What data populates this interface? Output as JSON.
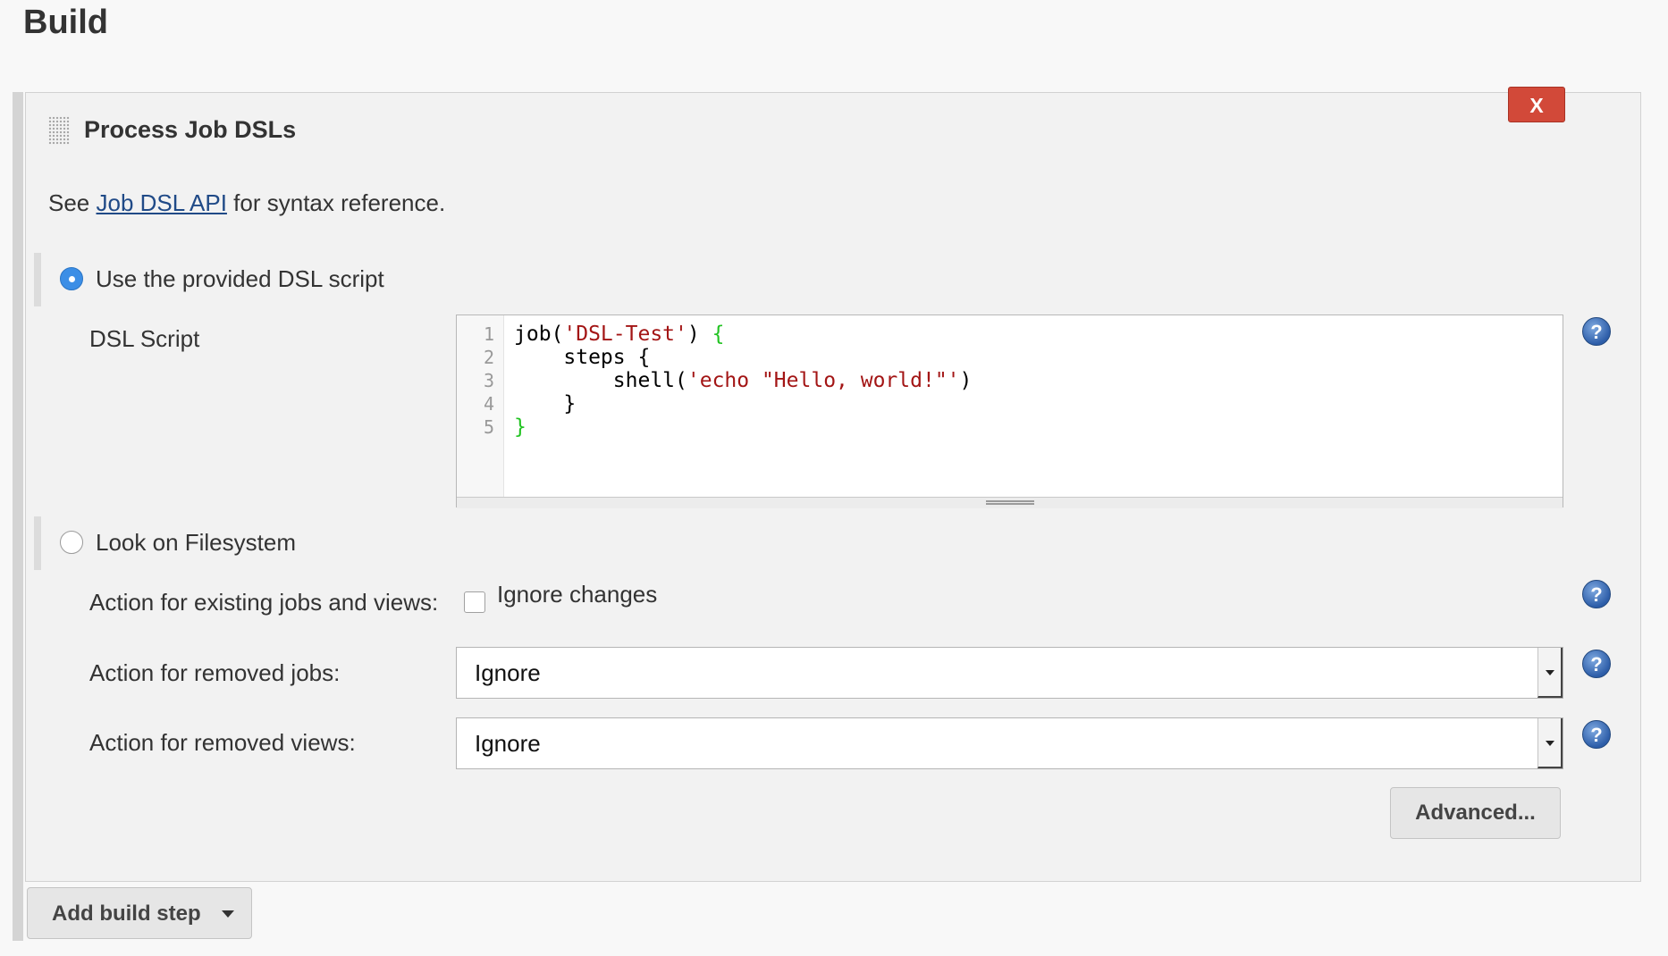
{
  "section": {
    "title": "Build"
  },
  "step": {
    "title": "Process Job DSLs",
    "close_label": "X",
    "see_prefix": "See ",
    "see_link": "Job DSL API",
    "see_suffix": " for syntax reference."
  },
  "options": {
    "provided_label": "Use the provided DSL script",
    "provided_checked": true,
    "filesystem_label": "Look on Filesystem",
    "filesystem_checked": false
  },
  "dsl": {
    "label": "DSL Script",
    "line_numbers": [
      "1",
      "2",
      "3",
      "4",
      "5"
    ],
    "lines": [
      [
        {
          "t": "job(",
          "c": "plain"
        },
        {
          "t": "'DSL-Test'",
          "c": "str"
        },
        {
          "t": ") ",
          "c": "plain"
        },
        {
          "t": "{",
          "c": "brace"
        }
      ],
      [
        {
          "t": "    steps {",
          "c": "plain"
        }
      ],
      [
        {
          "t": "        shell(",
          "c": "plain"
        },
        {
          "t": "'echo \"Hello, world!\"'",
          "c": "str"
        },
        {
          "t": ")",
          "c": "plain"
        }
      ],
      [
        {
          "t": "    }",
          "c": "plain"
        }
      ],
      [
        {
          "t": "}",
          "c": "brace"
        }
      ]
    ]
  },
  "existing": {
    "label": "Action for existing jobs and views:",
    "checkbox_label": "Ignore changes",
    "checked": false
  },
  "removed_jobs": {
    "label": "Action for removed jobs:",
    "value": "Ignore"
  },
  "removed_views": {
    "label": "Action for removed views:",
    "value": "Ignore"
  },
  "buttons": {
    "advanced": "Advanced...",
    "add_build_step": "Add build step"
  },
  "help_glyph": "?",
  "icons": {
    "help": "help-icon",
    "drag": "drag-handle-icon",
    "dropdown": "chevron-down-icon"
  },
  "colors": {
    "accent": "#3b8ee6",
    "close": "#d24939",
    "link": "#204a87",
    "code_string": "#a31515",
    "code_brace": "#22c322"
  }
}
